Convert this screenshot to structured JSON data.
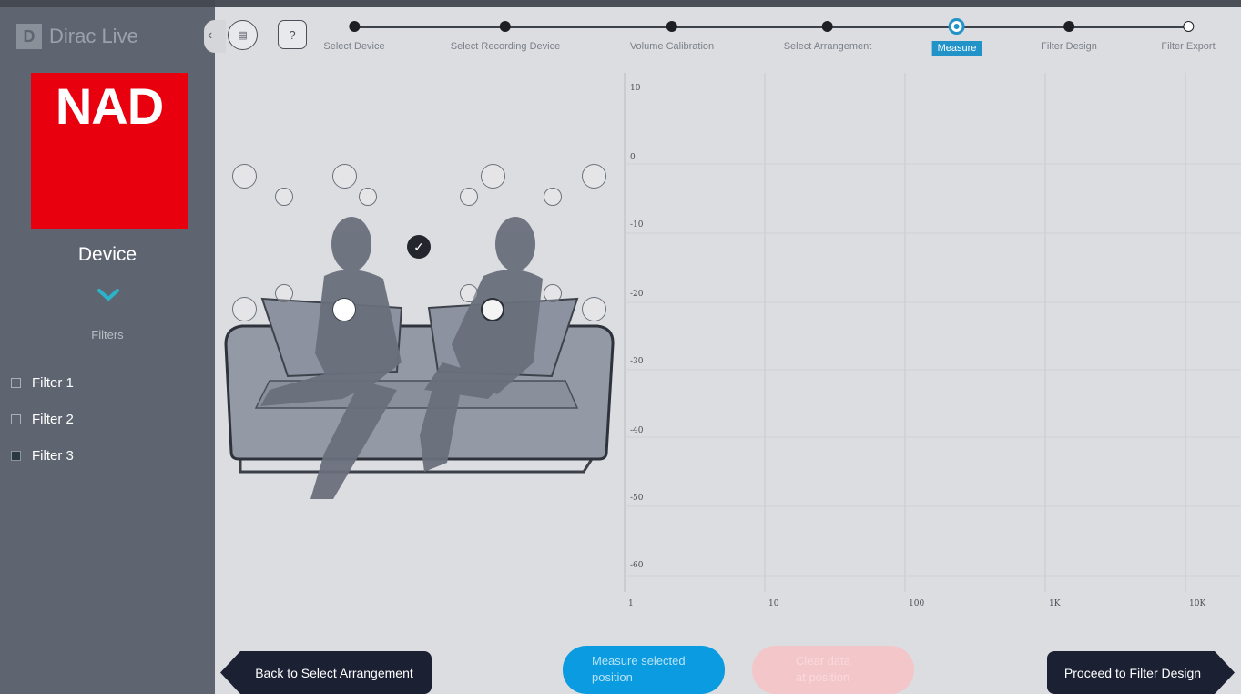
{
  "app": {
    "logo_letter": "D",
    "name": "Dirac Live"
  },
  "sidebar": {
    "collapse_glyph": "‹",
    "device_logo_text": "NAD",
    "device_label": "Device",
    "filters_heading": "Filters",
    "filters": [
      {
        "label": "Filter 1",
        "checked": false
      },
      {
        "label": "Filter 2",
        "checked": false
      },
      {
        "label": "Filter 3",
        "checked": true
      }
    ]
  },
  "toolbar": {
    "menu_icon_glyph": "▤",
    "help_glyph": "?"
  },
  "steps": [
    {
      "label": "Select Device",
      "state": "done"
    },
    {
      "label": "Select Recording Device",
      "state": "done"
    },
    {
      "label": "Volume Calibration",
      "state": "done"
    },
    {
      "label": "Select Arrangement",
      "state": "done"
    },
    {
      "label": "Measure",
      "state": "active"
    },
    {
      "label": "Filter Design",
      "state": "done"
    },
    {
      "label": "Filter Export",
      "state": "open"
    }
  ],
  "room": {
    "measured_check_glyph": "✓"
  },
  "graph": {
    "y_ticks": [
      "10",
      "0",
      "-10",
      "-20",
      "-30",
      "-40",
      "-50",
      "-60"
    ],
    "x_ticks": [
      "1",
      "10",
      "100",
      "1K",
      "10K"
    ]
  },
  "buttons": {
    "back": "Back to Select Arrangement",
    "measure_line1": "Measure selected",
    "measure_line2": "position",
    "clear_line1": "Clear data",
    "clear_line2": "at position",
    "proceed": "Proceed to Filter Design"
  },
  "colors": {
    "accent": "#2193c9",
    "measure_button": "#0a9be0",
    "nad_brand": "#e8000f",
    "nav_button": "#1b2033"
  }
}
